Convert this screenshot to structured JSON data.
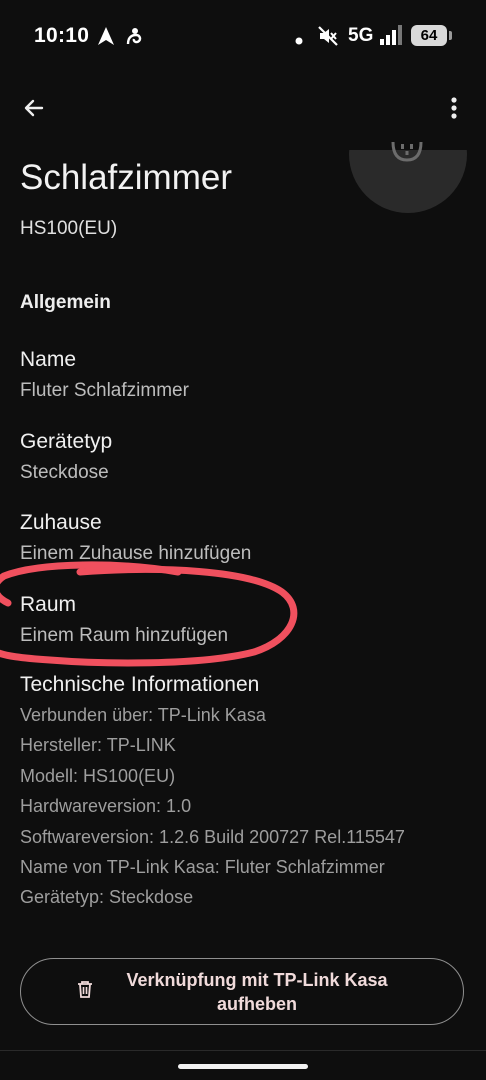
{
  "status_bar": {
    "time": "10:10",
    "network": "5G",
    "battery": "64",
    "icons": [
      "navigation-arrow-icon",
      "notification-app-icon",
      "dot-icon",
      "mute-icon",
      "signal-icon"
    ]
  },
  "app_bar": {
    "back_icon": "arrow-back-icon",
    "menu_icon": "more-vert-icon"
  },
  "device": {
    "name": "Schlafzimmer",
    "model": "HS100(EU)",
    "icon": "power-outlet-icon"
  },
  "section_title": "Allgemein",
  "fields": {
    "name": {
      "label": "Name",
      "value": "Fluter Schlafzimmer"
    },
    "type": {
      "label": "Gerätetyp",
      "value": "Steckdose"
    },
    "home": {
      "label": "Zuhause",
      "value": "Einem Zuhause hinzufügen"
    },
    "room": {
      "label": "Raum",
      "value": "Einem Raum hinzufügen"
    }
  },
  "tech": {
    "label": "Technische Informationen",
    "lines": [
      "Verbunden über: TP-Link Kasa",
      "Hersteller: TP-LINK",
      "Modell: HS100(EU)",
      "Hardwareversion: 1.0",
      "Softwareversion: 1.2.6 Build 200727 Rel.115547",
      "Name von TP-Link Kasa: Fluter Schlafzimmer",
      "Gerätetyp: Steckdose"
    ]
  },
  "unlink_button": {
    "label": "Verknüpfung mit TP-Link Kasa aufheben",
    "icon": "trash-icon"
  },
  "colors": {
    "background": "#0e0e0e",
    "annotation": "#f0505e"
  }
}
